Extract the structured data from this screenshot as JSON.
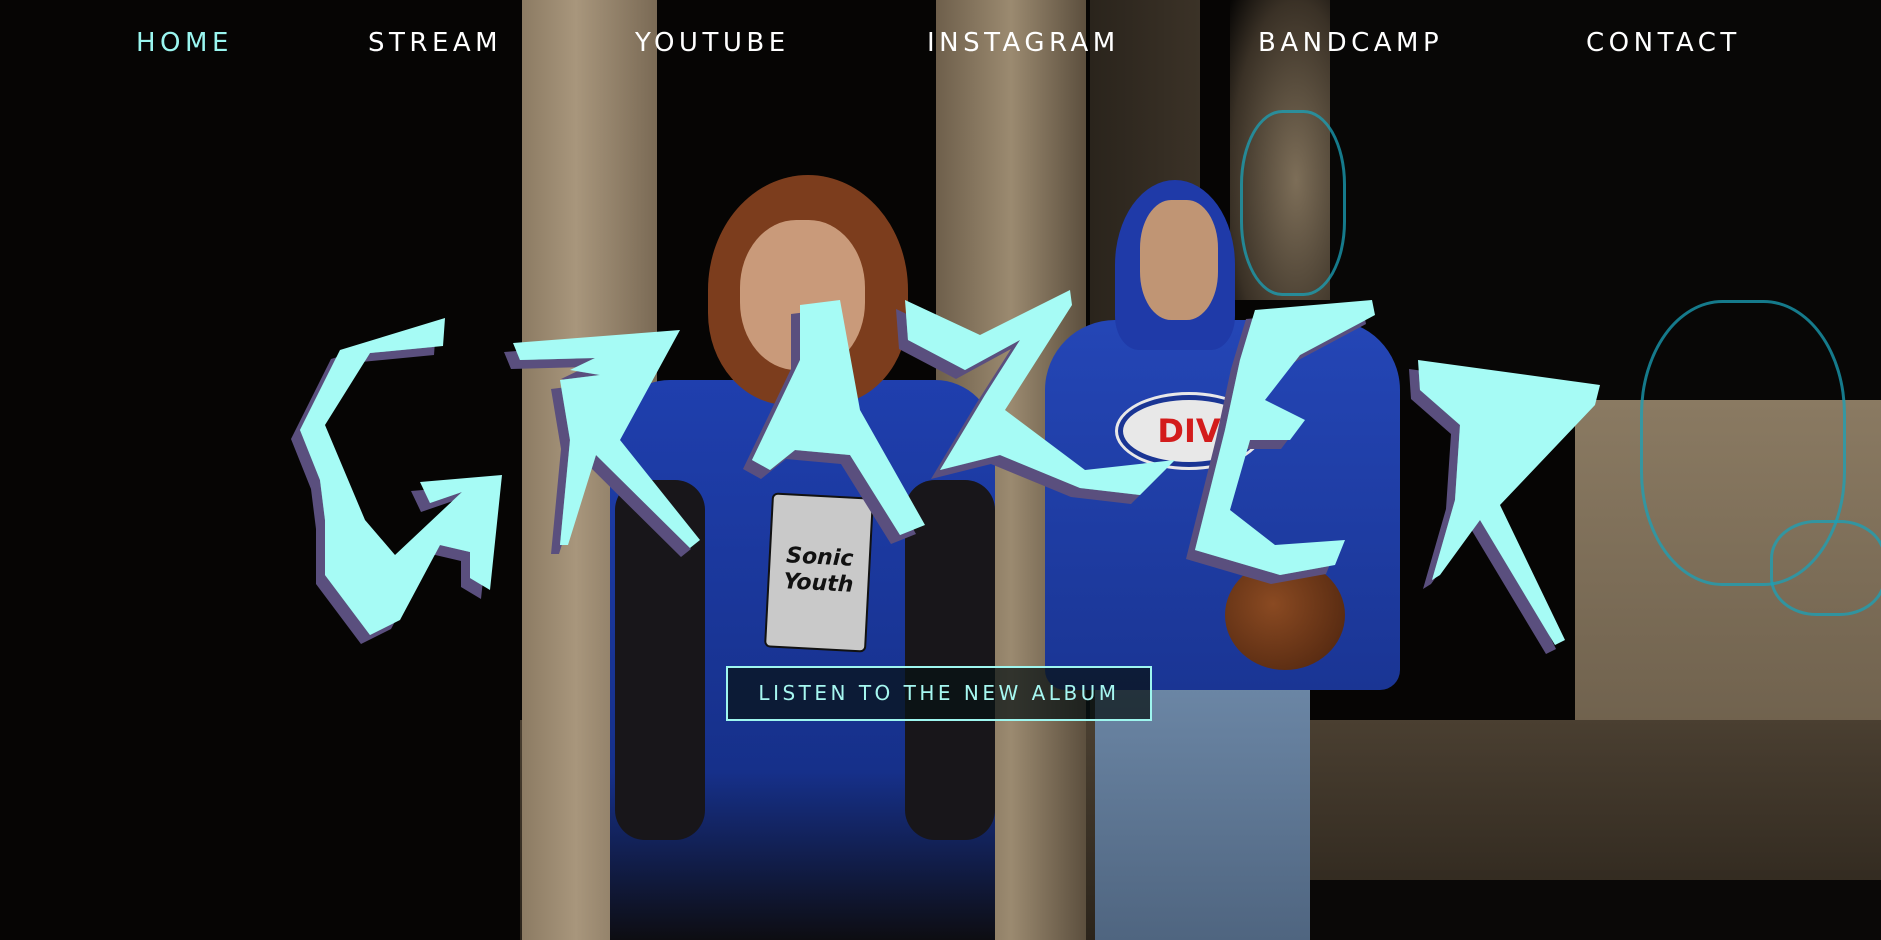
{
  "nav": {
    "items": [
      {
        "label": "HOME",
        "active": true
      },
      {
        "label": "STREAM",
        "active": false
      },
      {
        "label": "YOUTUBE",
        "active": false
      },
      {
        "label": "INSTAGRAM",
        "active": false
      },
      {
        "label": "BANDCAMP",
        "active": false
      },
      {
        "label": "CONTACT",
        "active": false
      }
    ]
  },
  "hero": {
    "band_logo_text": "GRAZER",
    "cta_label": "LISTEN TO THE NEW ALBUM"
  },
  "photo": {
    "tshirt_print": "Sonic Youth",
    "hoodie_print": "DIV"
  },
  "colors": {
    "accent": "#9af6f0",
    "nav_text": "#ffffff",
    "logo_fill": "#a6fbf5",
    "logo_shadow": "#5a4f7e"
  }
}
